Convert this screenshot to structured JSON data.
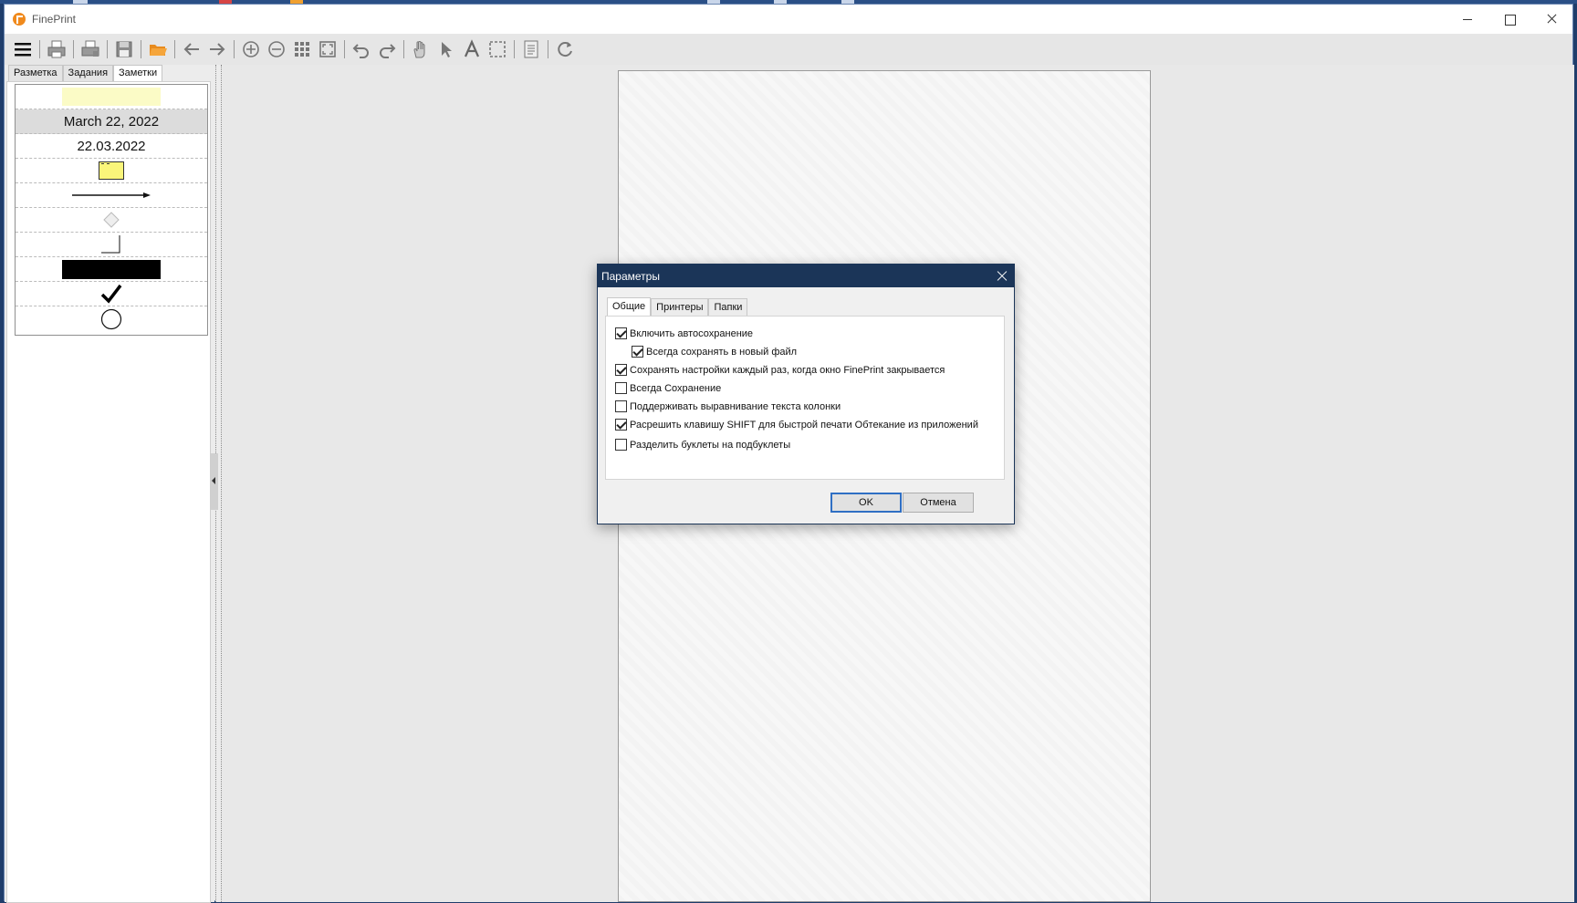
{
  "window": {
    "title": "FinePrint"
  },
  "toolbar": {
    "buttons": [
      "menu-icon",
      "print-icon",
      "print-settings-icon",
      "save-icon",
      "open-folder-icon",
      "back-arrow-icon",
      "forward-arrow-icon",
      "zoom-in-icon",
      "zoom-out-icon",
      "grid-icon",
      "fit-page-icon",
      "undo-icon",
      "redo-icon",
      "hand-icon",
      "pointer-icon",
      "text-icon",
      "select-icon",
      "notes-icon",
      "refresh-icon"
    ]
  },
  "left_panel": {
    "tabs": [
      "Разметка",
      "Задания",
      "Заметки"
    ],
    "active_tab": "Заметки",
    "stamps": {
      "date_long": "March 22, 2022",
      "date_short": "22.03.2022"
    }
  },
  "dialog": {
    "title": "Параметры",
    "tabs": [
      "Общие",
      "Принтеры",
      "Папки"
    ],
    "options": [
      {
        "label": "Включить автосохранение",
        "checked": true
      },
      {
        "label": "Всегда сохранять в новый файл",
        "checked": true
      },
      {
        "label": "Сохранять настройки каждый раз, когда окно FinePrint закрывается",
        "checked": true
      },
      {
        "label": "Всегда Сохранение",
        "checked": false
      },
      {
        "label": "Поддерживать выравнивание текста колонки",
        "checked": false
      },
      {
        "label": "Расрешить клавишу SHIFT для быстрой печати Обтекание из приложений",
        "checked": true
      },
      {
        "label": "Разделить буклеты на подбуклеты",
        "checked": false
      }
    ],
    "ok_label": "OK",
    "cancel_label": "Отмена"
  },
  "colors": {
    "dialog_title_bg": "#1b3558",
    "accent_orange": "#f08a1d",
    "highlight_yellow": "#fbfbc6",
    "sticky_yellow": "#faf57a"
  }
}
